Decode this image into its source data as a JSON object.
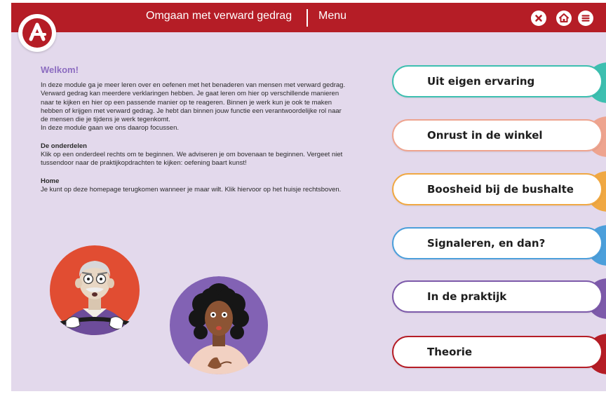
{
  "header": {
    "title": "Omgaan met verward gedrag",
    "menu_label": "Menu",
    "buttons": [
      {
        "name": "close-button",
        "icon": "close-icon"
      },
      {
        "name": "home-button",
        "icon": "home-icon"
      },
      {
        "name": "menu-button",
        "icon": "hamburger-menu-icon"
      }
    ]
  },
  "intro": {
    "heading": "Welkom!",
    "paragraph1": "In deze module ga je meer leren over en oefenen met het benaderen van mensen met verward gedrag. Verward gedrag kan meerdere verklaringen hebben. Je gaat leren om hier op verschillende manieren naar te kijken en hier op een passende manier op te reageren. Binnen je werk kun je ook te maken hebben of krijgen met verward gedrag. Je hebt dan binnen jouw functie een verantwoordelijke rol naar de mensen die je tijdens je werk tegenkomt.",
    "paragraph2": "In deze module gaan we ons daarop focussen.",
    "onderdelen_heading": "De onderdelen",
    "onderdelen_text": "Klik op een onderdeel rechts om te beginnen. We adviseren je om bovenaan te beginnen. Vergeet niet tussendoor naar de praktijkopdrachten te kijken: oefening baart kunst!",
    "home_heading": "Home",
    "home_text": "Je kunt op deze homepage terugkomen wanneer je maar wilt. Klik hiervoor op het huisje rechtsboven."
  },
  "modules": [
    {
      "label": "Uit eigen ervaring",
      "color": "#3dbfb0"
    },
    {
      "label": "Onrust in de winkel",
      "color": "#eea48f"
    },
    {
      "label": "Boosheid bij de bushalte",
      "color": "#f0a843"
    },
    {
      "label": "Signaleren, en dan?",
      "color": "#4c9fdb"
    },
    {
      "label": "In de praktijk",
      "color": "#7d5aaa"
    },
    {
      "label": "Theorie",
      "color": "#b51d26"
    }
  ],
  "colors": {
    "brand_red": "#b51d26",
    "background": "#e3d9ec",
    "welcome_purple": "#8c6cc0"
  }
}
